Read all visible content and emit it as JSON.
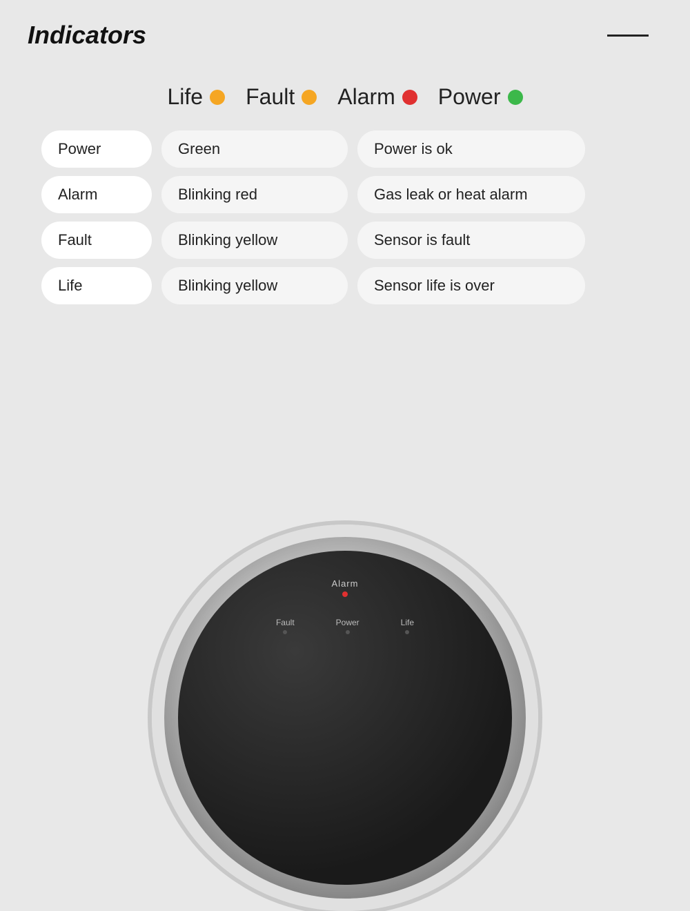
{
  "page": {
    "title": "Indicators",
    "background": "#e8e8e8"
  },
  "legend": [
    {
      "label": "Life",
      "dot_color": "yellow",
      "dot_class": "dot-yellow"
    },
    {
      "label": "Fault",
      "dot_color": "yellow",
      "dot_class": "dot-yellow"
    },
    {
      "label": "Alarm",
      "dot_color": "red",
      "dot_class": "dot-red"
    },
    {
      "label": "Power",
      "dot_color": "green",
      "dot_class": "dot-green"
    }
  ],
  "table": {
    "rows": [
      {
        "label": "Power",
        "color_desc": "Green",
        "status": "Power is ok"
      },
      {
        "label": "Alarm",
        "color_desc": "Blinking red",
        "status": "Gas leak or heat alarm"
      },
      {
        "label": "Fault",
        "color_desc": "Blinking yellow",
        "status": "Sensor is fault"
      },
      {
        "label": "Life",
        "color_desc": "Blinking yellow",
        "status": "Sensor life is over"
      }
    ]
  },
  "device": {
    "alarm_label": "Alarm",
    "indicators": [
      {
        "label": "Fault"
      },
      {
        "label": "Power"
      },
      {
        "label": "Life"
      }
    ]
  }
}
